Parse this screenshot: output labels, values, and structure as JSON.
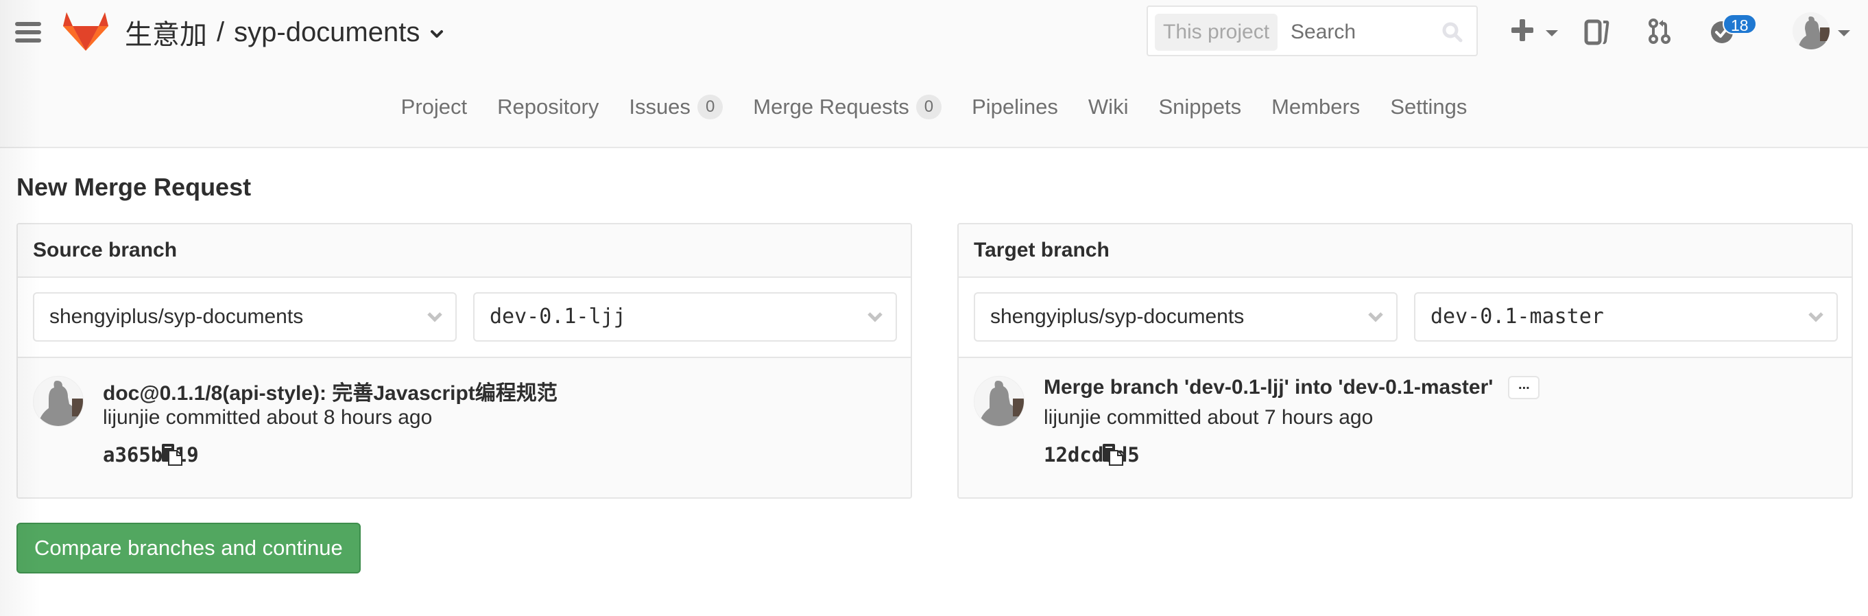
{
  "header": {
    "project_group": "生意加",
    "project_separator": "/",
    "project_name": "syp-documents",
    "search": {
      "scope_label": "This project",
      "placeholder": "Search"
    },
    "todos_count": "18",
    "colors": {
      "badge": "#1f78d1",
      "icon": "#707070"
    }
  },
  "nav": {
    "items": [
      {
        "label": "Project"
      },
      {
        "label": "Repository"
      },
      {
        "label": "Issues",
        "count": "0"
      },
      {
        "label": "Merge Requests",
        "count": "0"
      },
      {
        "label": "Pipelines"
      },
      {
        "label": "Wiki"
      },
      {
        "label": "Snippets"
      },
      {
        "label": "Members"
      },
      {
        "label": "Settings"
      }
    ]
  },
  "page": {
    "title": "New Merge Request"
  },
  "source": {
    "header": "Source branch",
    "project": "shengyiplus/syp-documents",
    "branch": "dev-0.1-ljj",
    "commit": {
      "title": "doc@0.1.1/8(api-style): 完善Javascript编程规范",
      "meta": "lijunjie committed about 8 hours ago",
      "sha": "a365bb19"
    }
  },
  "target": {
    "header": "Target branch",
    "project": "shengyiplus/syp-documents",
    "branch": "dev-0.1-master",
    "commit": {
      "title": "Merge branch 'dev-0.1-ljj' into 'dev-0.1-master'",
      "more_label": "...",
      "meta": "lijunjie committed about 7 hours ago",
      "sha": "12dcd8d5"
    }
  },
  "actions": {
    "compare_label": "Compare branches and continue",
    "compare_color": "#52a760"
  }
}
